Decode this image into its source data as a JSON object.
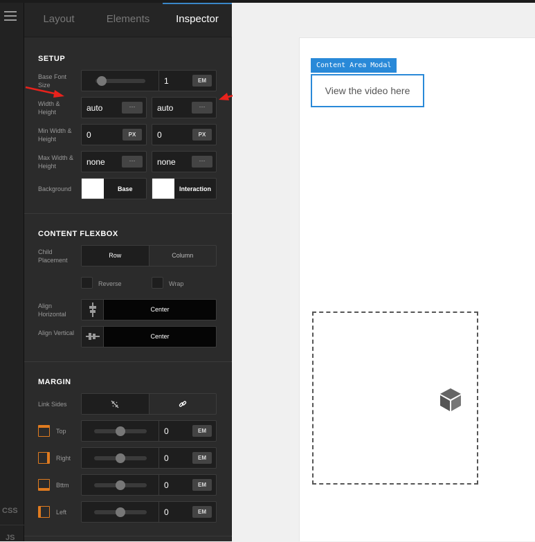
{
  "tabs": [
    {
      "label": "Layout",
      "active": false
    },
    {
      "label": "Elements",
      "active": false
    },
    {
      "label": "Inspector",
      "active": true
    }
  ],
  "rail": {
    "css": "CSS",
    "js": "JS"
  },
  "setup": {
    "title": "SETUP",
    "base_font": {
      "label": "Base Font Size",
      "value": "1",
      "unit": "EM"
    },
    "width_height": {
      "label": "Width & Height",
      "width": "auto",
      "height": "auto",
      "more": "···"
    },
    "min_wh": {
      "label": "Min Width & Height",
      "width": "0",
      "height": "0",
      "unit": "PX"
    },
    "max_wh": {
      "label": "Max Width & Height",
      "width": "none",
      "height": "none",
      "more": "···"
    },
    "background": {
      "label": "Background",
      "base": "Base",
      "interaction": "Interaction",
      "base_color": "#ffffff",
      "interaction_color": "#ffffff"
    }
  },
  "flexbox": {
    "title": "CONTENT FLEXBOX",
    "child_placement": {
      "label": "Child Placement",
      "options": [
        "Row",
        "Column"
      ],
      "selected": "Row"
    },
    "reverse": "Reverse",
    "wrap": "Wrap",
    "align_h": {
      "label": "Align Horizontal",
      "value": "Center"
    },
    "align_v": {
      "label": "Align Vertical",
      "value": "Center"
    }
  },
  "margin": {
    "title": "MARGIN",
    "link_sides": {
      "label": "Link Sides"
    },
    "sides": [
      {
        "label": "Top",
        "value": "0",
        "unit": "EM"
      },
      {
        "label": "Right",
        "value": "0",
        "unit": "EM"
      },
      {
        "label": "Bttm",
        "value": "0",
        "unit": "EM"
      },
      {
        "label": "Left",
        "value": "0",
        "unit": "EM"
      }
    ]
  },
  "canvas": {
    "modal_tag": "Content Area Modal",
    "modal_text": "View the video here"
  },
  "colors": {
    "accent": "#2989d8",
    "orange": "#e07b1f",
    "arrow": "#e8221c"
  },
  "icons": [
    "menu-icon",
    "height-align-icon",
    "width-align-icon",
    "unlink-icon",
    "link-icon",
    "margin-top-icon",
    "margin-right-icon",
    "margin-bottom-icon",
    "margin-left-icon",
    "cube-icon"
  ]
}
